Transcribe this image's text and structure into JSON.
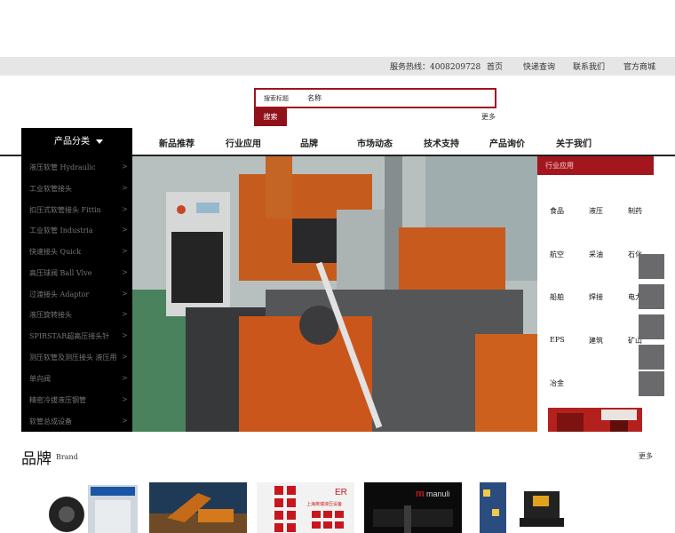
{
  "topbar": {
    "hotline": "服务热线：4008209728",
    "links": [
      "首页",
      "快递查询",
      "联系我们",
      "官方商城"
    ]
  },
  "search": {
    "category_label": "搜索标题",
    "keyword": "名称",
    "button": "搜索",
    "more": "更多"
  },
  "nav": {
    "category_tab": "产品分类",
    "items": [
      "新品推荐",
      "行业应用",
      "品牌",
      "市场动态",
      "技术支持",
      "产品询价",
      "关于我们"
    ]
  },
  "sidebar": {
    "items": [
      "液压软管 Hydraulic",
      "工业软管接头",
      "扣压式软管接头 Fittin",
      "工业软管 Industria",
      "快速接头 Quick",
      "高压球阀 Ball Vlve",
      "过渡接头 Adaptor",
      "液压旋转接头",
      "SPIRSTAR超高压接头针",
      "测压软管及测压接头 液压用",
      "单向阀",
      "精密冷拔液压钢管",
      "软管总成设备"
    ],
    "arrow": ">"
  },
  "industry": {
    "title": "行业应用",
    "items": [
      "食品",
      "液压",
      "制药",
      "航空",
      "采油",
      "石化",
      "船舶",
      "焊接",
      "电力",
      "EPS",
      "建筑",
      "矿山",
      "冶金"
    ]
  },
  "brand": {
    "title": "品牌",
    "subtitle": "Brand",
    "more": "更多",
    "logo_texts": [
      "ER",
      "上海英瑞液压设备",
      "manuli"
    ]
  },
  "colors": {
    "accent": "#a3161d",
    "search_border": "#a01220",
    "sidebar_bg": "#000000",
    "topbar_bg": "#e6e6e6"
  }
}
